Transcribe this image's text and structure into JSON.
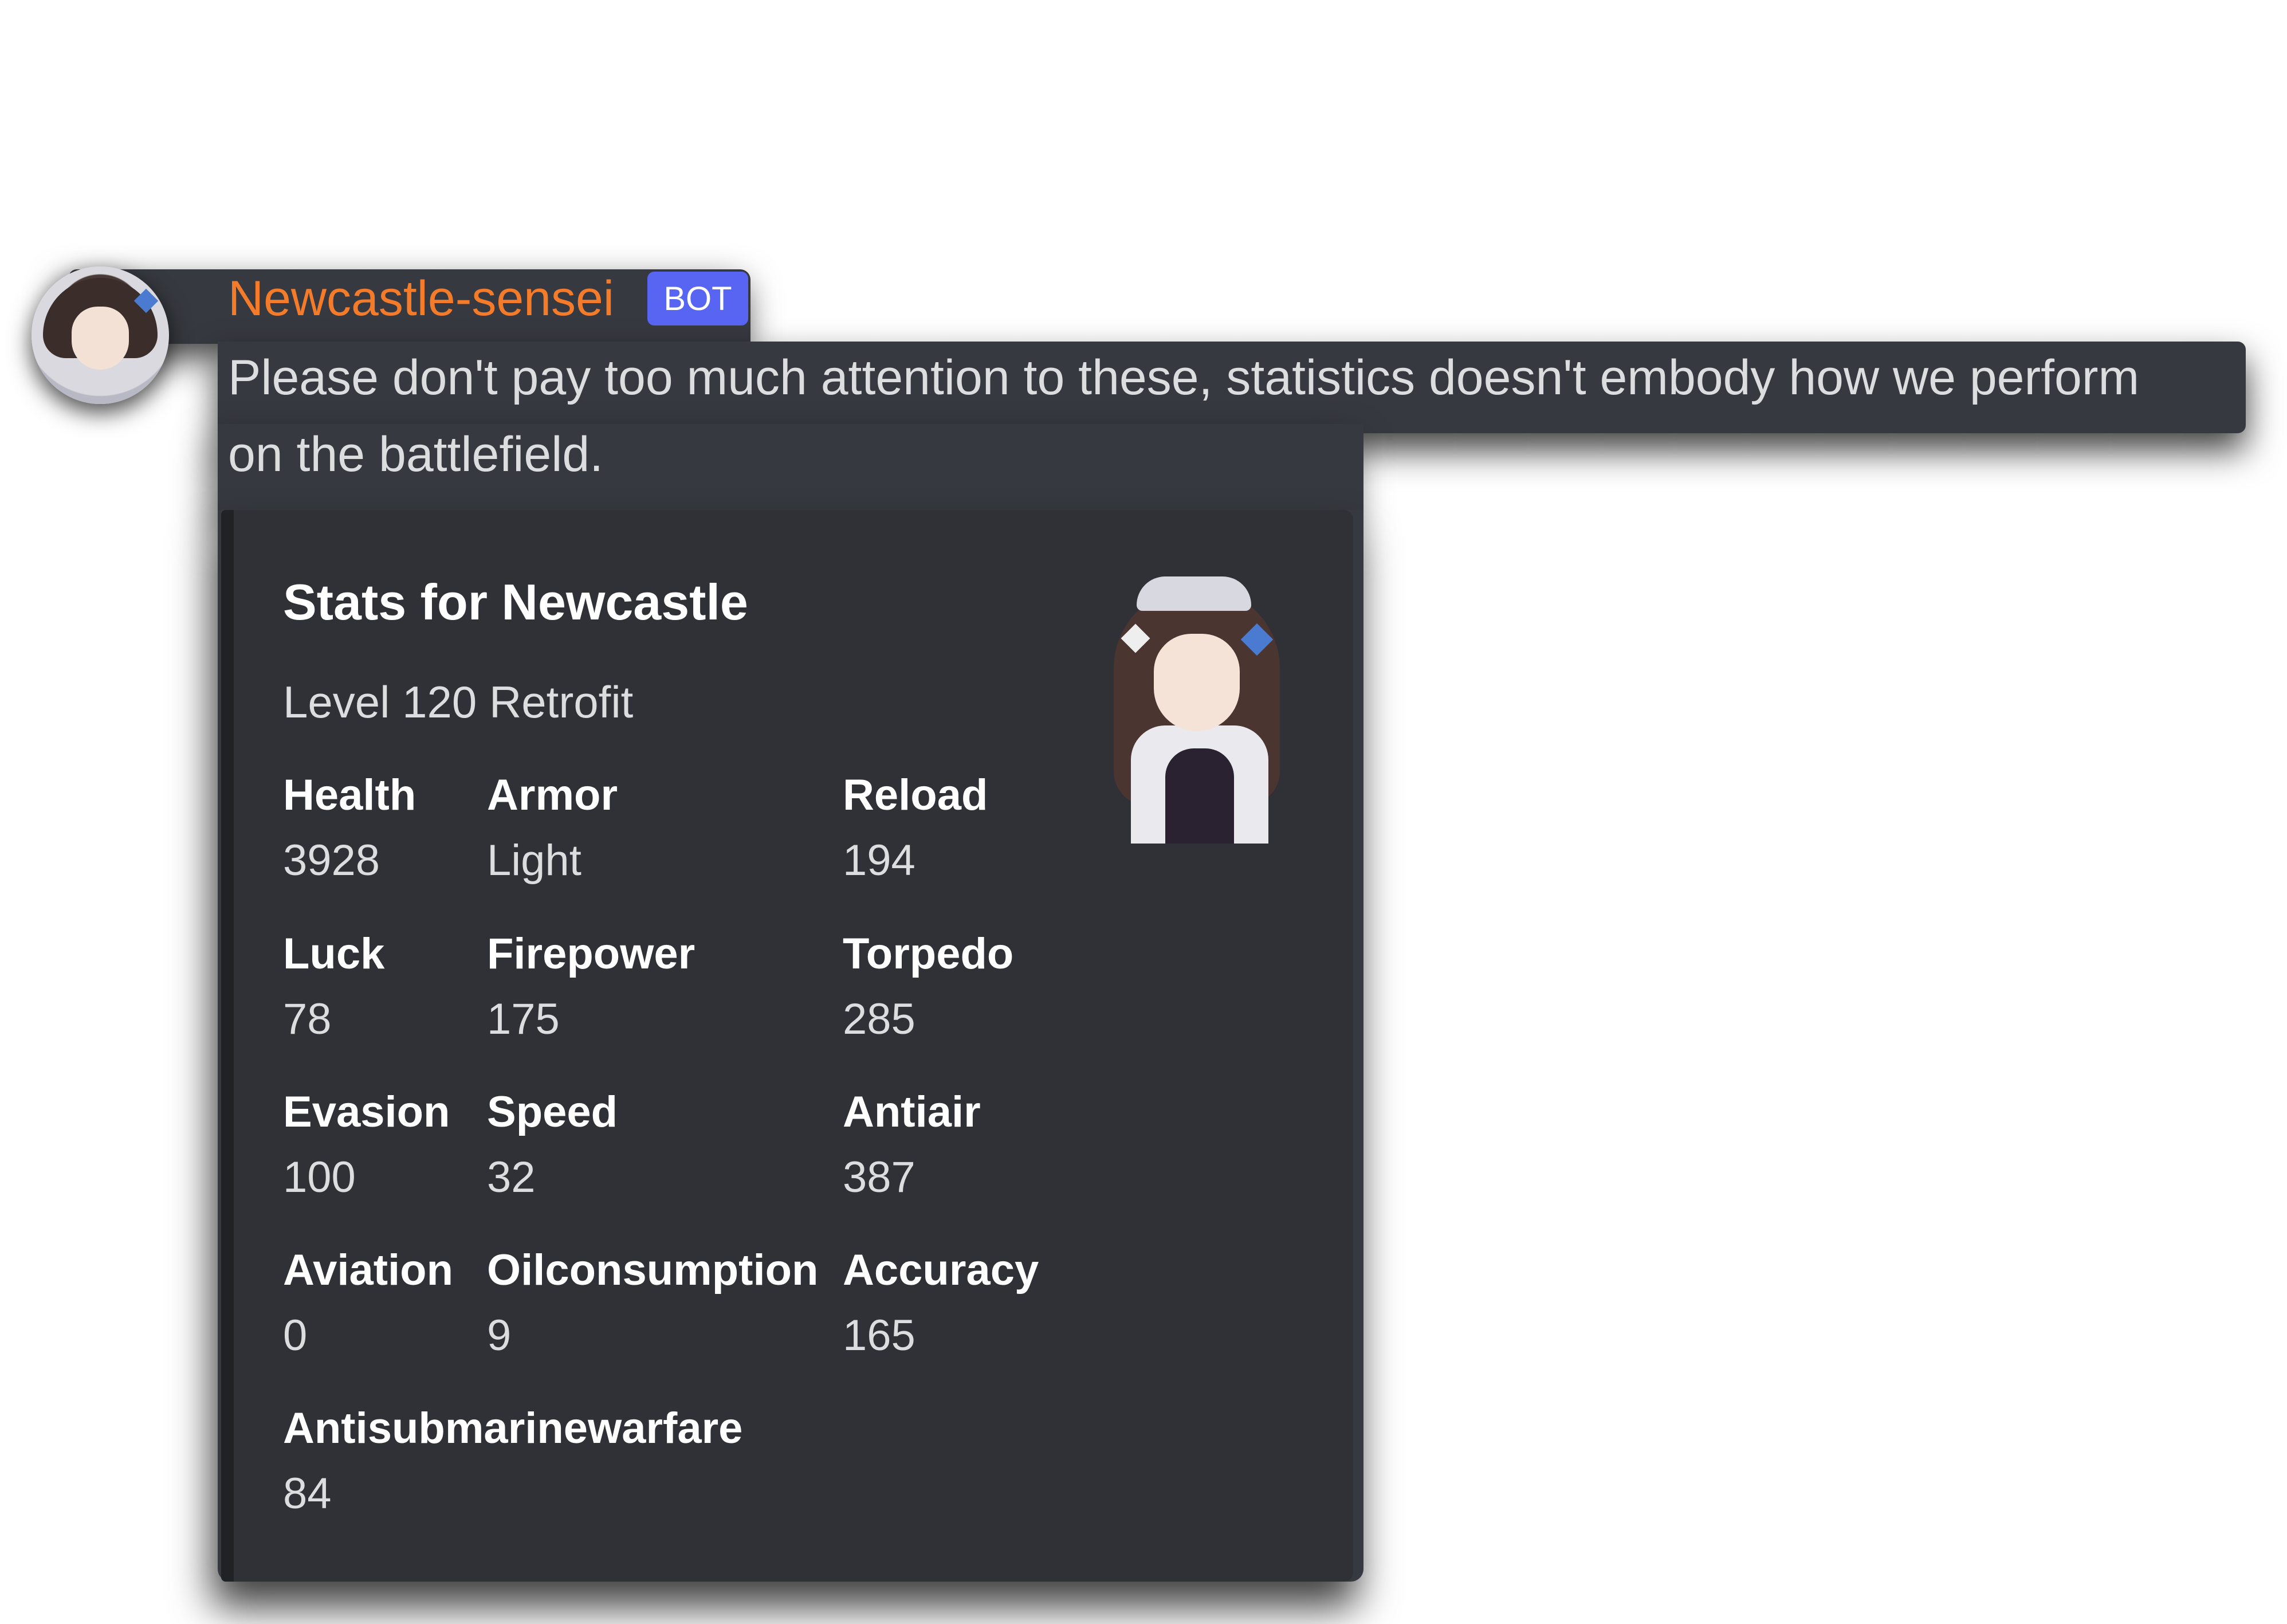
{
  "message": {
    "author": "Newcastle-sensei",
    "author_color": "#f47b2a",
    "bot_tag": "BOT",
    "text_line1": "Please don't pay too much attention to these, statistics doesn't embody how we perform",
    "text_line2": "on the battlefield."
  },
  "embed": {
    "title": "Stats for Newcastle",
    "description": "Level 120 Retrofit",
    "fields": [
      {
        "name": "Health",
        "value": "3928"
      },
      {
        "name": "Armor",
        "value": "Light"
      },
      {
        "name": "Reload",
        "value": "194"
      },
      {
        "name": "Luck",
        "value": "78"
      },
      {
        "name": "Firepower",
        "value": "175"
      },
      {
        "name": "Torpedo",
        "value": "285"
      },
      {
        "name": "Evasion",
        "value": "100"
      },
      {
        "name": "Speed",
        "value": "32"
      },
      {
        "name": "Antiair",
        "value": "387"
      },
      {
        "name": "Aviation",
        "value": "0"
      },
      {
        "name": "Oilconsumption",
        "value": "9"
      },
      {
        "name": "Accuracy",
        "value": "165"
      },
      {
        "name": "Antisubmarinewarfare",
        "value": "84"
      }
    ]
  },
  "colors": {
    "background": "#36393f",
    "embed_background": "#2f3136",
    "bot_tag": "#5865f2"
  }
}
